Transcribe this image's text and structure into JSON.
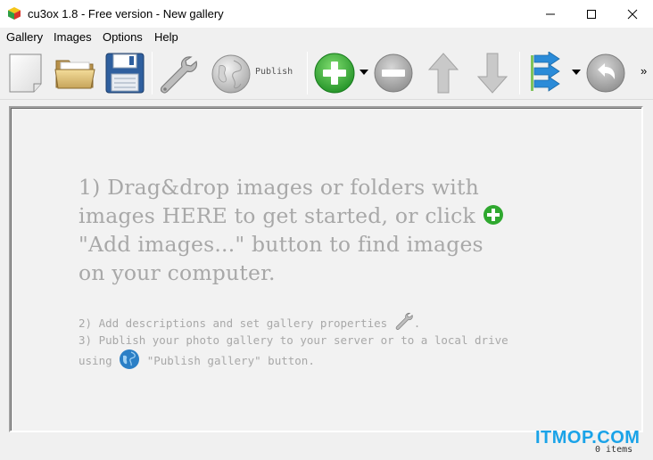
{
  "window": {
    "title": "cu3ox 1.8 - Free version - New gallery"
  },
  "menu": {
    "items": [
      "Gallery",
      "Images",
      "Options",
      "Help"
    ]
  },
  "toolbar": {
    "publish_label": "Publish",
    "overflow_label": "»",
    "icons": [
      "new-document-icon",
      "open-folder-icon",
      "save-floppy-icon",
      "wrench-icon",
      "globe-icon",
      "add-icon",
      "remove-icon",
      "move-up-icon",
      "move-down-icon",
      "sort-arrows-icon",
      "undo-icon"
    ]
  },
  "canvas": {
    "hint_line1": "1) Drag&drop images or folders with",
    "hint_line2": "images HERE to get started, or click",
    "hint_line3": "\"Add images...\" button to find images",
    "hint_line4": "on your computer.",
    "step2": "2) Add descriptions and set gallery properties",
    "step2_end": ".",
    "step3_line1": "3) Publish your photo gallery to your server or to a local drive",
    "step3_using": "using",
    "step3_tail": "\"Publish gallery\" button."
  },
  "status": {
    "count": "0 items"
  },
  "watermark": "ITMOP.COM",
  "colors": {
    "add_green": "#2fa82f",
    "hint_gray": "#a8a8a8",
    "watermark_blue": "#1aa3e8"
  }
}
